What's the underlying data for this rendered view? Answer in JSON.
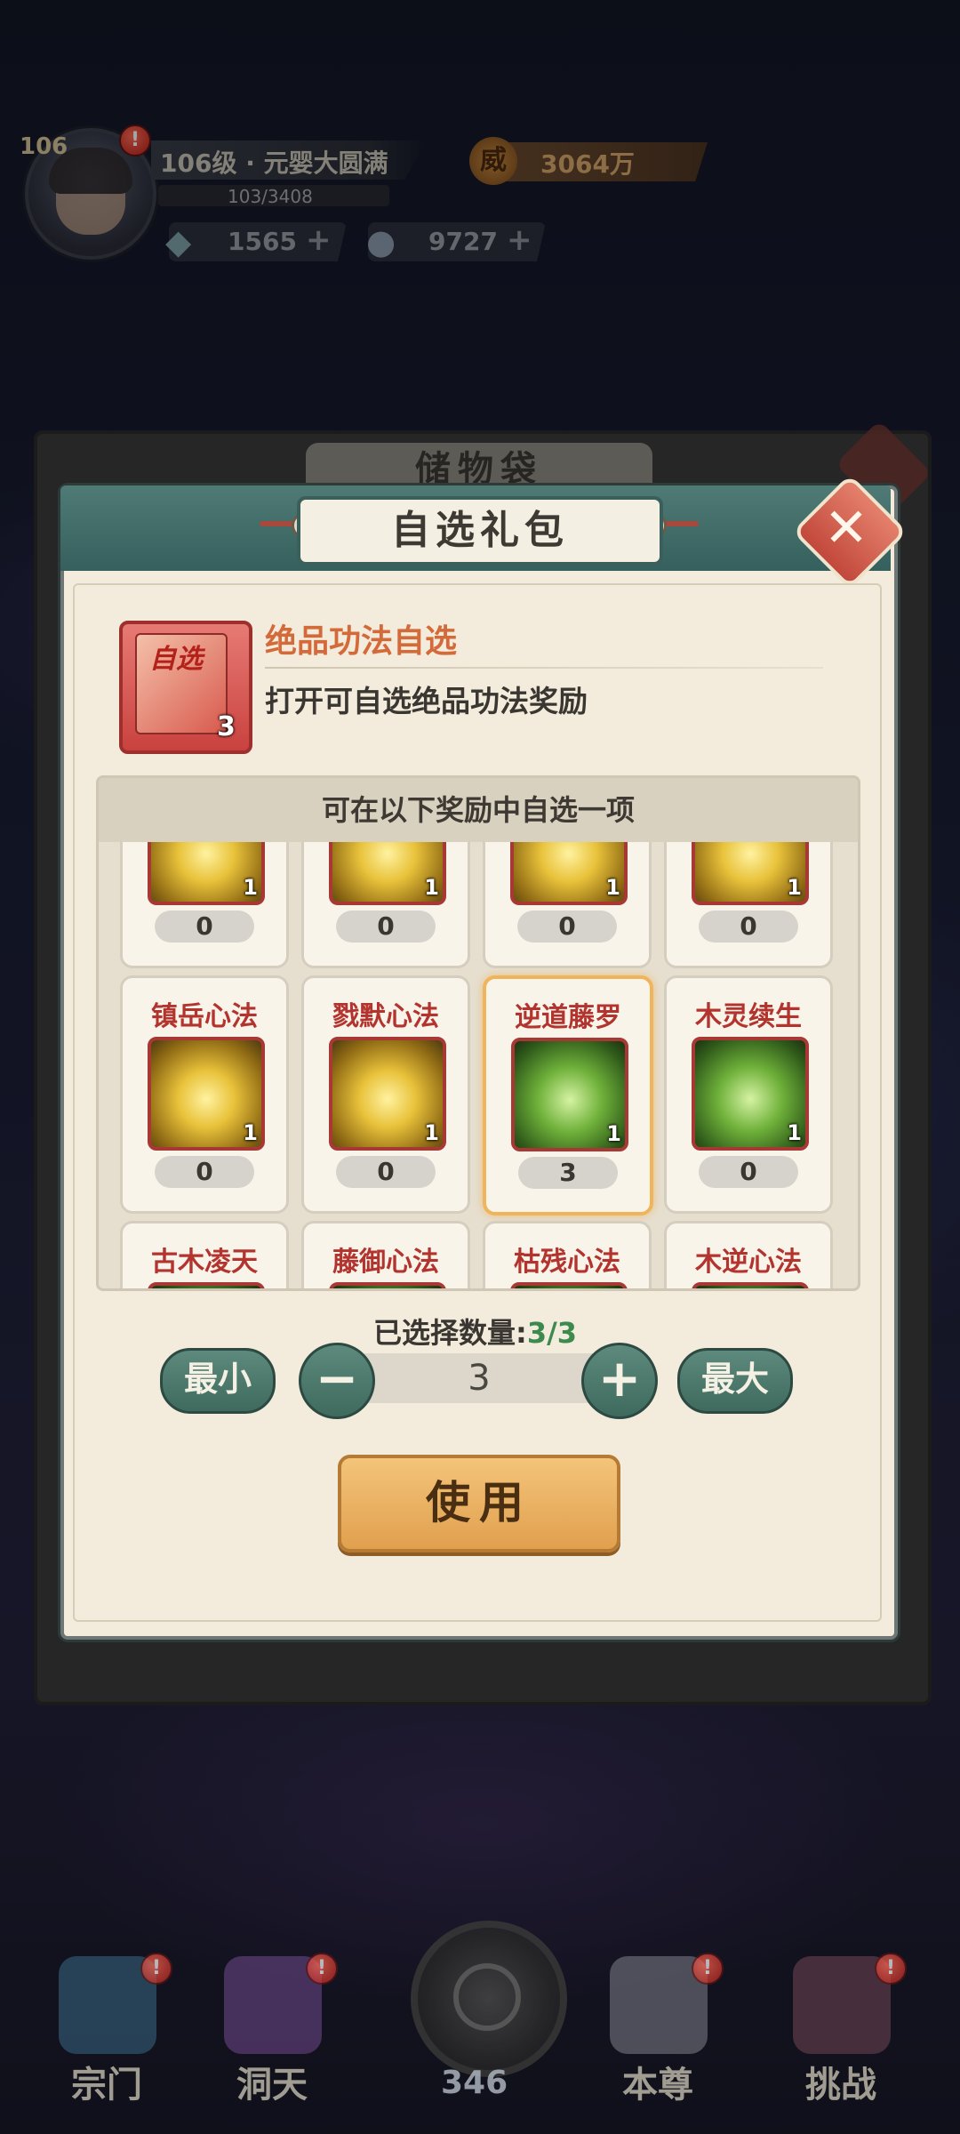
{
  "player": {
    "level": "106",
    "realm": "106级 · 元婴大圆满",
    "exp": "103/3408",
    "power_icon": "威",
    "power": "3064万",
    "gems": "1565",
    "coins": "9727",
    "badge": "!"
  },
  "storage": {
    "title": "储物袋"
  },
  "dialog": {
    "title": "自选礼包",
    "item": {
      "icon_tag": "自选",
      "count": "3",
      "name": "绝品功法自选",
      "description": "打开可自选绝品功法奖励"
    },
    "rewards_header": "可在以下奖励中自选一项",
    "rewards": [
      {
        "name": "",
        "icon": "gold",
        "qty": "1",
        "count": "0",
        "selected": false
      },
      {
        "name": "",
        "icon": "gold",
        "qty": "1",
        "count": "0",
        "selected": false
      },
      {
        "name": "",
        "icon": "gold",
        "qty": "1",
        "count": "0",
        "selected": false
      },
      {
        "name": "",
        "icon": "gold",
        "qty": "1",
        "count": "0",
        "selected": false
      },
      {
        "name": "镇岳心法",
        "icon": "gold",
        "qty": "1",
        "count": "0",
        "selected": false
      },
      {
        "name": "戮默心法",
        "icon": "gold",
        "qty": "1",
        "count": "0",
        "selected": false
      },
      {
        "name": "逆道藤罗",
        "icon": "green",
        "qty": "1",
        "count": "3",
        "selected": true
      },
      {
        "name": "木灵续生",
        "icon": "green",
        "qty": "1",
        "count": "0",
        "selected": false
      },
      {
        "name": "古木凌天",
        "icon": "green",
        "qty": "",
        "count": "",
        "selected": false
      },
      {
        "name": "藤御心法",
        "icon": "green",
        "qty": "",
        "count": "",
        "selected": false
      },
      {
        "name": "枯残心法",
        "icon": "green",
        "qty": "",
        "count": "",
        "selected": false
      },
      {
        "name": "木逆心法",
        "icon": "green",
        "qty": "",
        "count": "",
        "selected": false
      }
    ],
    "quantity": {
      "label": "已选择数量:",
      "value": "3/3",
      "min_label": "最小",
      "minus": "−",
      "input_value": "3",
      "plus": "+",
      "max_label": "最大"
    },
    "use_label": "使用",
    "close_symbol": "✕"
  },
  "nav": {
    "items": [
      {
        "label": "宗门",
        "color": "#3b6f8f"
      },
      {
        "label": "洞天",
        "color": "#7a4f9a"
      },
      {
        "label": "本尊",
        "color": "#8a8a95"
      },
      {
        "label": "挑战",
        "color": "#7a4a5a"
      }
    ],
    "spirit": "346"
  }
}
